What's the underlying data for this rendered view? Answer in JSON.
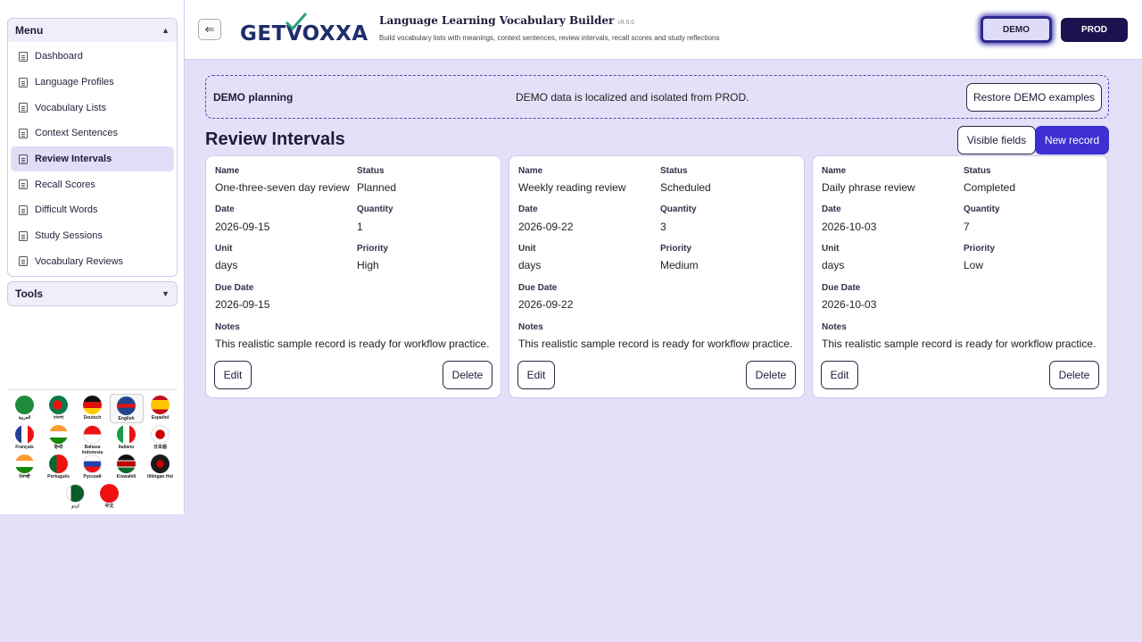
{
  "sidebar": {
    "menu_title": "Menu",
    "items": [
      {
        "label": "Dashboard"
      },
      {
        "label": "Language Profiles"
      },
      {
        "label": "Vocabulary Lists"
      },
      {
        "label": "Context Sentences"
      },
      {
        "label": "Review Intervals",
        "active": true
      },
      {
        "label": "Recall Scores"
      },
      {
        "label": "Difficult Words"
      },
      {
        "label": "Study Sessions"
      },
      {
        "label": "Vocabulary Reviews"
      }
    ],
    "tools_title": "Tools",
    "languages": [
      {
        "name": "العربية",
        "color": "#1f8a3c"
      },
      {
        "name": "বাংলা",
        "color": "#0a7a4a"
      },
      {
        "name": "Deutsch",
        "color": "#d11"
      },
      {
        "name": "English",
        "color": "#21468b",
        "selected": true
      },
      {
        "name": "Español",
        "color": "#e8b400"
      },
      {
        "name": "Français",
        "color": "#1f3f99"
      },
      {
        "name": "हिन्दी",
        "color": "#ff9933"
      },
      {
        "name": "Bahasa Indonesia",
        "color": "#e11"
      },
      {
        "name": "Italiano",
        "color": "#169c46"
      },
      {
        "name": "日本語",
        "color": "#ffffff"
      },
      {
        "name": "ਪੰਜਾਬੀ",
        "color": "#ff9933"
      },
      {
        "name": "Português",
        "color": "#0a6a2a"
      },
      {
        "name": "Русский",
        "color": "#2140b0"
      },
      {
        "name": "Kiswahili",
        "color": "#111111"
      },
      {
        "name": "tlhIngan Hol",
        "color": "#1a1a1a"
      },
      {
        "name": "اردو",
        "color": "#0b5c2a"
      },
      {
        "name": "中文",
        "color": "#e11"
      }
    ]
  },
  "header": {
    "back_icon": "⇐",
    "logo_text": "GETVOXXA",
    "app_title": "Language Learning Vocabulary Builder",
    "version": "v9.0.0",
    "subtitle": "Build vocabulary lists with meanings, context sentences, review intervals, recall scores and study reflections",
    "env_demo": "DEMO",
    "env_prod": "PROD"
  },
  "banner": {
    "title": "DEMO planning",
    "message": "DEMO data is localized and isolated from PROD.",
    "restore_label": "Restore DEMO examples"
  },
  "main": {
    "page_title": "Review Intervals",
    "visible_fields_label": "Visible fields",
    "new_record_label": "New record",
    "labels": {
      "name": "Name",
      "status": "Status",
      "date": "Date",
      "quantity": "Quantity",
      "unit": "Unit",
      "priority": "Priority",
      "due_date": "Due Date",
      "notes": "Notes",
      "edit": "Edit",
      "delete": "Delete"
    },
    "records": [
      {
        "name": "One-three-seven day review",
        "status": "Planned",
        "date": "2026-09-15",
        "quantity": "1",
        "unit": "days",
        "priority": "High",
        "due_date": "2026-09-15",
        "notes": "This realistic sample record is ready for workflow practice."
      },
      {
        "name": "Weekly reading review",
        "status": "Scheduled",
        "date": "2026-09-22",
        "quantity": "3",
        "unit": "days",
        "priority": "Medium",
        "due_date": "2026-09-22",
        "notes": "This realistic sample record is ready for workflow practice."
      },
      {
        "name": "Daily phrase review",
        "status": "Completed",
        "date": "2026-10-03",
        "quantity": "7",
        "unit": "days",
        "priority": "Low",
        "due_date": "2026-10-03",
        "notes": "This realistic sample record is ready for workflow practice."
      }
    ]
  }
}
